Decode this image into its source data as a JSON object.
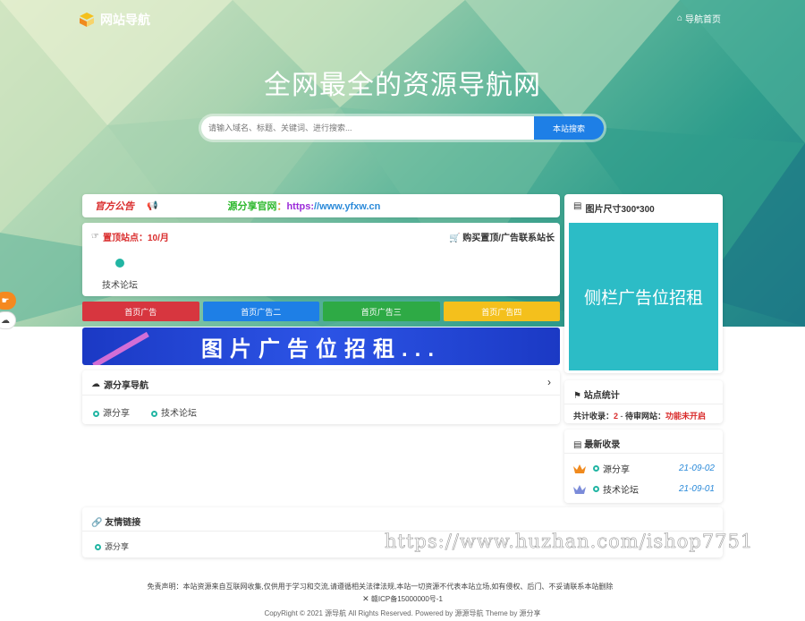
{
  "header": {
    "logo_text": "网站导航",
    "nav_home": "导航首页",
    "hero_title": "全网最全的资源导航网",
    "search_placeholder": "请输入域名、标题、关键词、进行搜索...",
    "search_button": "本站搜索"
  },
  "notice": {
    "label": "官方公告",
    "text_a": "源分享官网",
    "text_b": "：",
    "text_c": "https:",
    "text_d": "//www.yfxw.cn"
  },
  "pinned": {
    "title": "置顶站点：10/月",
    "buy_link": "购买置顶/广告联系站长",
    "sites": [
      "技术论坛"
    ]
  },
  "ad_buttons": [
    {
      "label": "首页广告",
      "color": "#d7363f"
    },
    {
      "label": "首页广告二",
      "color": "#1e7fe6"
    },
    {
      "label": "首页广告三",
      "color": "#2eaa45"
    },
    {
      "label": "首页广告四",
      "color": "#f4c01c"
    }
  ],
  "banner_text": "图片广告位招租...",
  "nav_section": {
    "title": "源分享导航",
    "links": [
      "源分享",
      "技术论坛"
    ]
  },
  "side_ad": {
    "title": "图片尺寸300*300",
    "text": "侧栏广告位招租"
  },
  "stats": {
    "title": "站点统计",
    "total_label": "共计收录：",
    "total_value": "2",
    "sep": " - ",
    "pending_label": "待审网站：",
    "pending_value": "功能未开启"
  },
  "latest": {
    "title": "最新收录",
    "items": [
      {
        "name": "源分享",
        "date": "21-09-02",
        "crown_color": "#f08a1e"
      },
      {
        "name": "技术论坛",
        "date": "21-09-01",
        "crown_color": "#7b8bd9"
      }
    ]
  },
  "friend_links": {
    "title": "友情链接",
    "links": [
      "源分享"
    ]
  },
  "watermark": "https://www.huzhan.com/ishop7751",
  "footer": {
    "disclaimer": "免责声明：本站资源来自互联网收集,仅供用于学习和交流,请遵循相关法律法规,本站一切资源不代表本站立场,如有侵权、后门、不妥请联系本站删除",
    "icp": "赣ICP备15000000号-1",
    "copyright": "CopyRight © 2021 源导航 All Rights Reserved. Powered by 源源导航 Theme by 源分享"
  },
  "icons": [
    "logo-cube-icon",
    "home-icon",
    "megaphone-icon",
    "thumb-icon",
    "cart-icon",
    "map-pin-icon",
    "cloud-icon",
    "chevron-right-icon",
    "book-icon",
    "flag-icon",
    "crown-icon",
    "link-icon",
    "hand-icon"
  ]
}
